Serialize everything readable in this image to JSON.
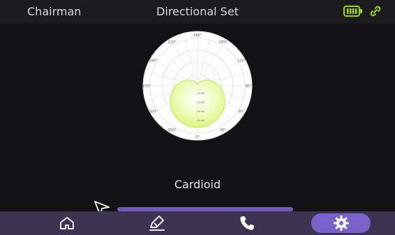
{
  "header": {
    "left_title": "Chairman",
    "center_title": "Directional Set",
    "icons": [
      "battery-icon",
      "link-icon"
    ]
  },
  "polar": {
    "angles": [
      "180°",
      "150°",
      "120°",
      "90°",
      "60°",
      "30°",
      "0°",
      "330°",
      "300°",
      "270°",
      "240°",
      "210°"
    ],
    "db_labels": [
      "-10 dB",
      "-20 dB",
      "-30 dB",
      "-40 dB"
    ]
  },
  "main": {
    "pattern_label": "Cardioid",
    "slider_level": 1.0
  },
  "footer": {
    "tabs": [
      {
        "icon": "home-icon",
        "active": false
      },
      {
        "icon": "edit-icon",
        "active": false
      },
      {
        "icon": "phone-icon",
        "active": false
      },
      {
        "icon": "gear-icon",
        "active": true
      }
    ]
  },
  "colors": {
    "header_bg": "#1b1b1d",
    "footer_bg": "#3b3450",
    "accent_purple": "#7a62c8",
    "slider_purple": "#6f5cb8",
    "pattern_fill": "#dff57a",
    "battery_green": "#a4d600"
  }
}
